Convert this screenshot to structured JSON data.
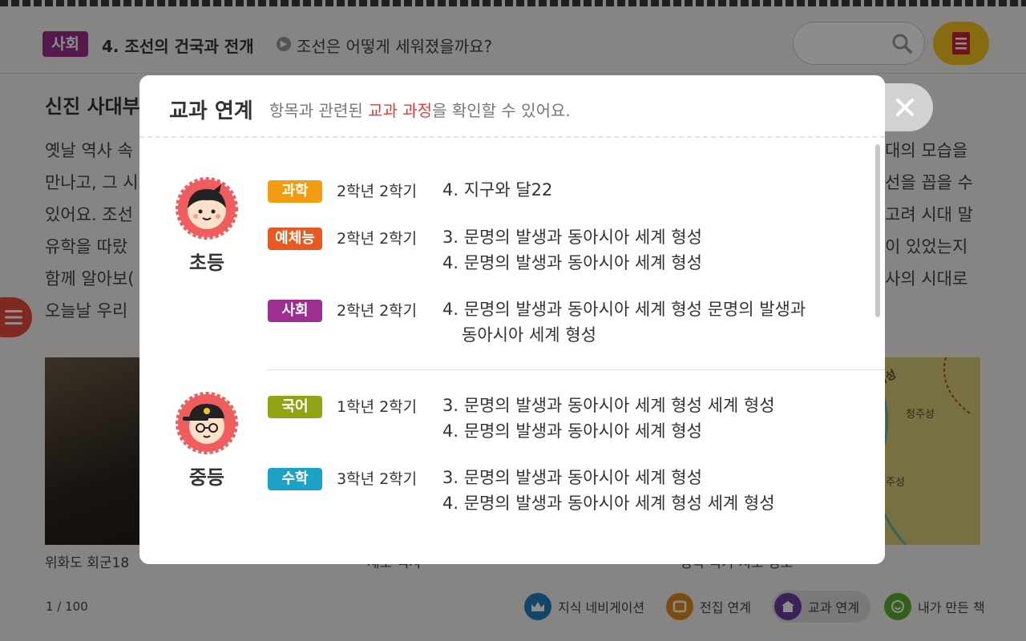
{
  "header": {
    "subject_badge": "사회",
    "chapter_title": "4. 조선의 건국과 전개",
    "lesson_title": "조선은 어떻게 세워졌을까요?"
  },
  "page": {
    "heading": "신진 사대부",
    "left_lines": [
      "옛날 역사 속",
      "만나고, 그 시",
      "있어요. 조선",
      "유학을 따랐",
      "함께 알아보(",
      "오늘날 우리"
    ],
    "right_lines": [
      "대의 모습을",
      "선을 꼽을 수",
      "고려 시대 말",
      "이 있었는지",
      "사의 시대로"
    ],
    "captions": [
      "위화도 회군18",
      "세도 역사",
      "성곽 국가 지도 영토"
    ],
    "map_labels": [
      "고려성",
      "청주성",
      "주성"
    ],
    "page_counter": "1 / 100"
  },
  "bottom_nav": [
    {
      "label": "지식 네비게이션",
      "icon": "crown-icon",
      "color": "#1f7ec2"
    },
    {
      "label": "전집 연계",
      "icon": "books-icon",
      "color": "#e08a1e"
    },
    {
      "label": "교과 연계",
      "icon": "school-icon",
      "color": "#6a3ea1",
      "active": true
    },
    {
      "label": "내가 만든 책",
      "icon": "smile-icon",
      "color": "#5cae2e"
    }
  ],
  "modal": {
    "title": "교과 연계",
    "subtitle_before": "항목과 관련된 ",
    "subtitle_highlight": "교과 과정",
    "subtitle_after": "을 확인할 수 있어요.",
    "levels": [
      {
        "name": "초등",
        "rows": [
          {
            "subject": "과학",
            "color": "#f39c12",
            "grade": "2학년 2학기",
            "units": [
              "4. 지구와 달22"
            ]
          },
          {
            "subject": "예체능",
            "color": "#e8591f",
            "grade": "2학년 2학기",
            "units": [
              "3. 문명의 발생과 동아시아 세계 형성",
              "4. 문명의 발생과 동아시아 세계 형성"
            ]
          },
          {
            "subject": "사회",
            "color": "#9c2f8f",
            "grade": "2학년 2학기",
            "units": [
              "4. 문명의 발생과 동아시아 세계 형성 문명의 발생과",
              "동아시아 세계 형성"
            ]
          }
        ]
      },
      {
        "name": "중등",
        "rows": [
          {
            "subject": "국어",
            "color": "#8fa315",
            "grade": "1학년 2학기",
            "units": [
              "3. 문명의 발생과 동아시아 세계 형성 세계 형성",
              "4. 문명의 발생과 동아시아 세계 형성"
            ]
          },
          {
            "subject": "수학",
            "color": "#1ba2c6",
            "grade": "3학년 2학기",
            "units": [
              "3. 문명의 발생과 동아시아 세계 형성",
              "4. 문명의 발생과 동아시아 세계 형성 세계 형성"
            ]
          }
        ]
      }
    ]
  }
}
